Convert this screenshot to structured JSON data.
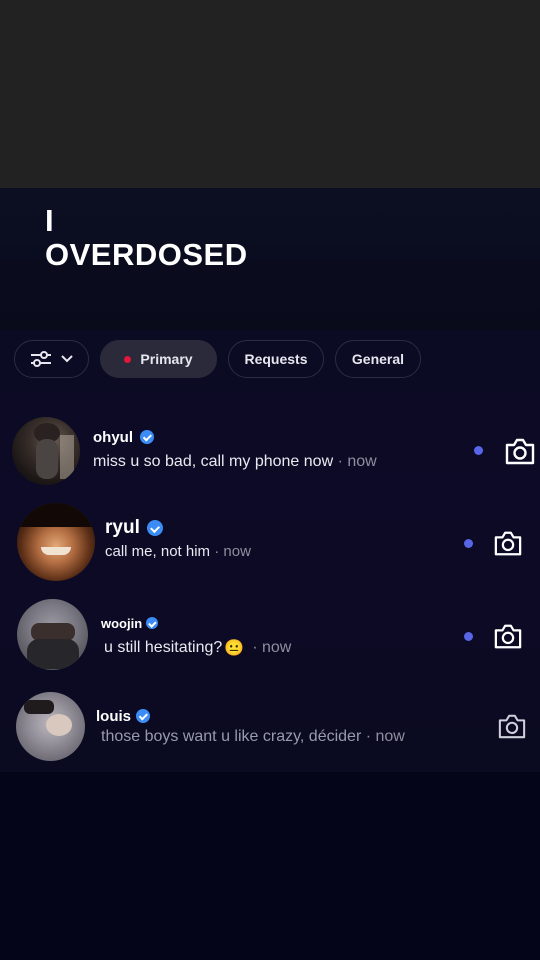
{
  "title": {
    "line1": "I",
    "line2": "OVERDOSED"
  },
  "filters": {
    "filter_icon": "sliders-icon",
    "tabs": [
      {
        "label": "Primary",
        "active": true
      },
      {
        "label": "Requests",
        "active": false
      },
      {
        "label": "General",
        "active": false
      }
    ]
  },
  "threads": [
    {
      "name": "ohyul",
      "verified": true,
      "message": "miss u so bad, call my phone now",
      "time": "· now",
      "unread": true
    },
    {
      "name": "ryul",
      "verified": true,
      "message": "call me, not him",
      "time": "· now",
      "unread": true
    },
    {
      "name": "woojin",
      "verified": true,
      "message": "u still hesitating?",
      "emoji": "😐",
      "time": "· now",
      "unread": true
    },
    {
      "name": "louis",
      "verified": true,
      "message": "those boys want u like crazy, décider",
      "time": "· now",
      "unread": false
    }
  ],
  "colors": {
    "accent": "#5865e6",
    "verified": "#3b8cf5",
    "primary_dot": "#e0173b",
    "background": "#0b0b24"
  }
}
